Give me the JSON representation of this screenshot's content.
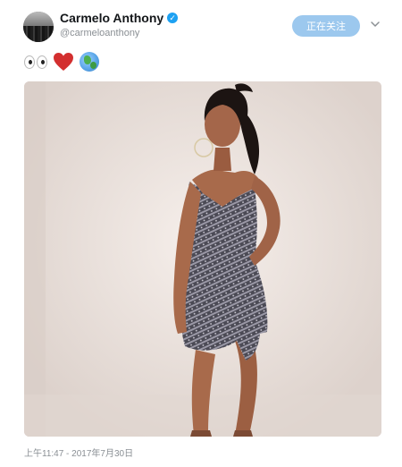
{
  "tweet": {
    "author_name": "Carmelo Anthony",
    "author_handle": "@carmeloanthony",
    "follow_label": "正在关注",
    "emojis": [
      "eyes-emoji",
      "red-heart-emoji",
      "globe-emoji"
    ],
    "timestamp": "上午11:47 - 2017年7月30日"
  },
  "colors": {
    "verified_blue": "#1da1f2",
    "follow_button_bg": "#9cc8ee",
    "secondary_text": "#8a8f94",
    "heart_red": "#d32f2f"
  }
}
